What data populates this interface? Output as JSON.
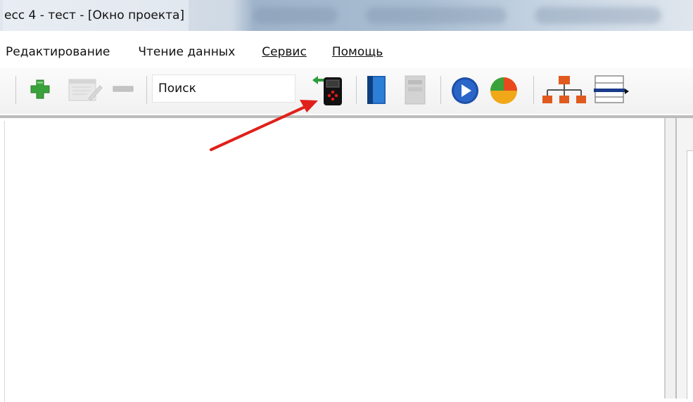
{
  "window": {
    "title": "есс 4 - тест - [Окно проекта]"
  },
  "menu": {
    "items": [
      {
        "label": "Редактирование"
      },
      {
        "label": "Чтение данных"
      },
      {
        "label": "Сервис"
      },
      {
        "label": "Помощь"
      }
    ]
  },
  "toolbar": {
    "search_label": "Поиск",
    "icons": [
      "add-icon",
      "edit-icon",
      "remove-icon",
      "read-device-icon",
      "book-icon",
      "book-disabled-icon",
      "play-icon",
      "pie-chart-icon",
      "hierarchy-icon",
      "report-format-icon"
    ]
  },
  "annotation": {
    "arrow_color": "#e0201a"
  }
}
